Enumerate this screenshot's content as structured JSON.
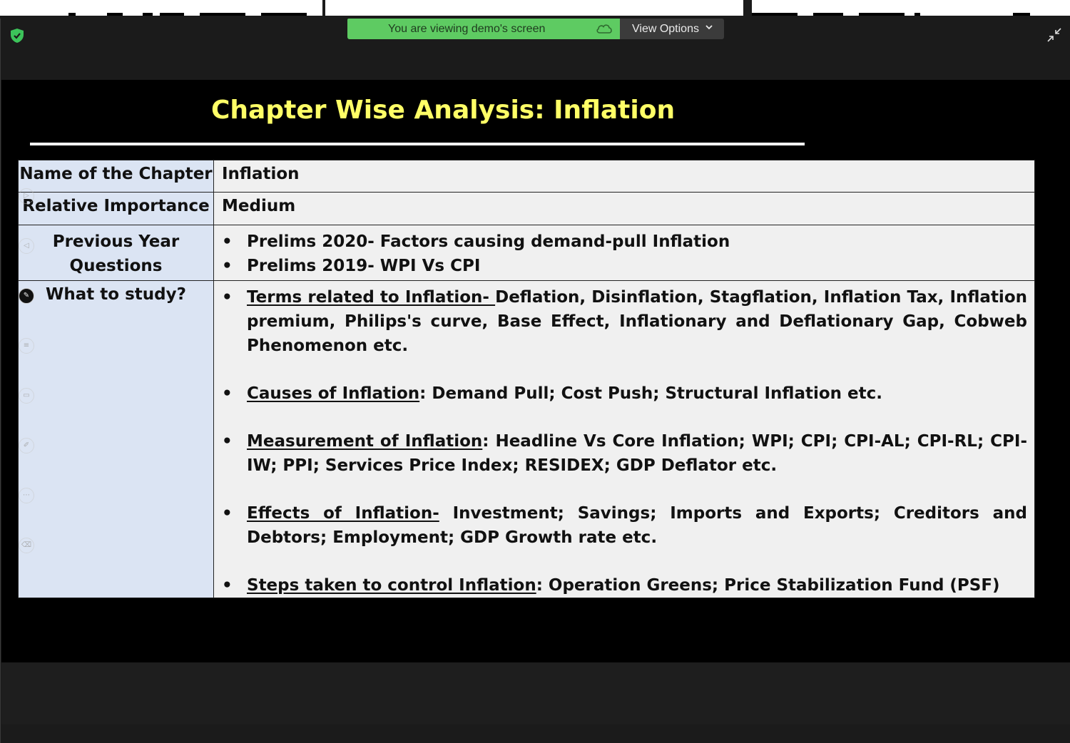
{
  "window": {
    "viewing_banner": "You are viewing demo's screen",
    "view_options_label": "View Options",
    "icons": [
      "shield-icon",
      "cloud-icon",
      "chevron-down-icon",
      "collapse-icon"
    ]
  },
  "slide": {
    "title": "Chapter Wise Analysis: Inflation",
    "title_color": "#ffff66",
    "rows": {
      "name": {
        "label": "Name of the Chapter",
        "value": "Inflation"
      },
      "importance": {
        "label": "Relative Importance",
        "value": "Medium"
      },
      "pyq": {
        "label_line1": "Previous Year",
        "label_line2": "Questions",
        "items": [
          "Prelims 2020- Factors causing demand-pull Inflation",
          "Prelims 2019- WPI Vs CPI"
        ]
      },
      "study": {
        "label": "What to study?",
        "items": [
          {
            "heading": "Terms related to Inflation- ",
            "text": "Deflation, Disinflation, Stagflation, Inflation Tax, Inflation premium, Philips's curve, Base Effect, Inflationary and Deflationary Gap, Cobweb Phenomenon etc."
          },
          {
            "heading": "Causes of Inflation",
            "text": ": Demand Pull; Cost Push; Structural Inflation etc."
          },
          {
            "heading": "Measurement of Inflation",
            "text": ": Headline Vs Core Inflation; WPI; CPI; CPI-AL; CPI-RL; CPI-IW; PPI; Services Price Index; RESIDEX; GDP Deflator etc."
          },
          {
            "heading": "Effects of Inflation-",
            "text": " Investment; Savings; Imports and Exports; Creditors and Debtors; Employment; GDP Growth rate etc."
          },
          {
            "heading": "Steps taken to control Inflation",
            "text": ": Operation Greens; Price Stabilization Fund (PSF)"
          }
        ]
      }
    }
  }
}
